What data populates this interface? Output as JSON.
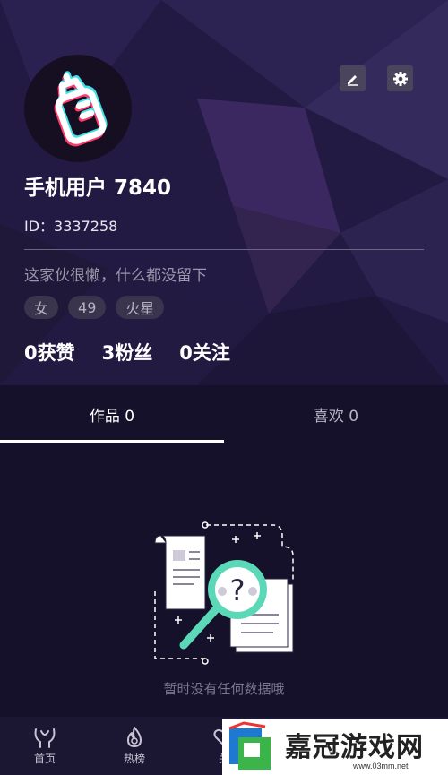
{
  "profile": {
    "username": "手机用户 7840",
    "id_text": "ID：3337258",
    "bio": "这家伙很懒，什么都没留下",
    "tags": [
      "女",
      "49",
      "火星"
    ],
    "stats": [
      "0获赞",
      "3粉丝",
      "0关注"
    ]
  },
  "tabs": [
    {
      "label": "作品 0",
      "active": true
    },
    {
      "label": "喜欢 0",
      "active": false
    }
  ],
  "empty_state": {
    "message": "暂时没有任何数据哦"
  },
  "bottom_nav": [
    {
      "label": "首页",
      "icon": "home-icon"
    },
    {
      "label": "热榜",
      "icon": "flame-icon"
    },
    {
      "label": "关",
      "icon": "heart-icon"
    }
  ],
  "watermark": {
    "text": "嘉冠游戏网",
    "url": "www.03mm.net"
  },
  "colors": {
    "header_bg": "#231a43",
    "page_bg": "#15112a",
    "accent_teal": "#5ad8b8"
  }
}
